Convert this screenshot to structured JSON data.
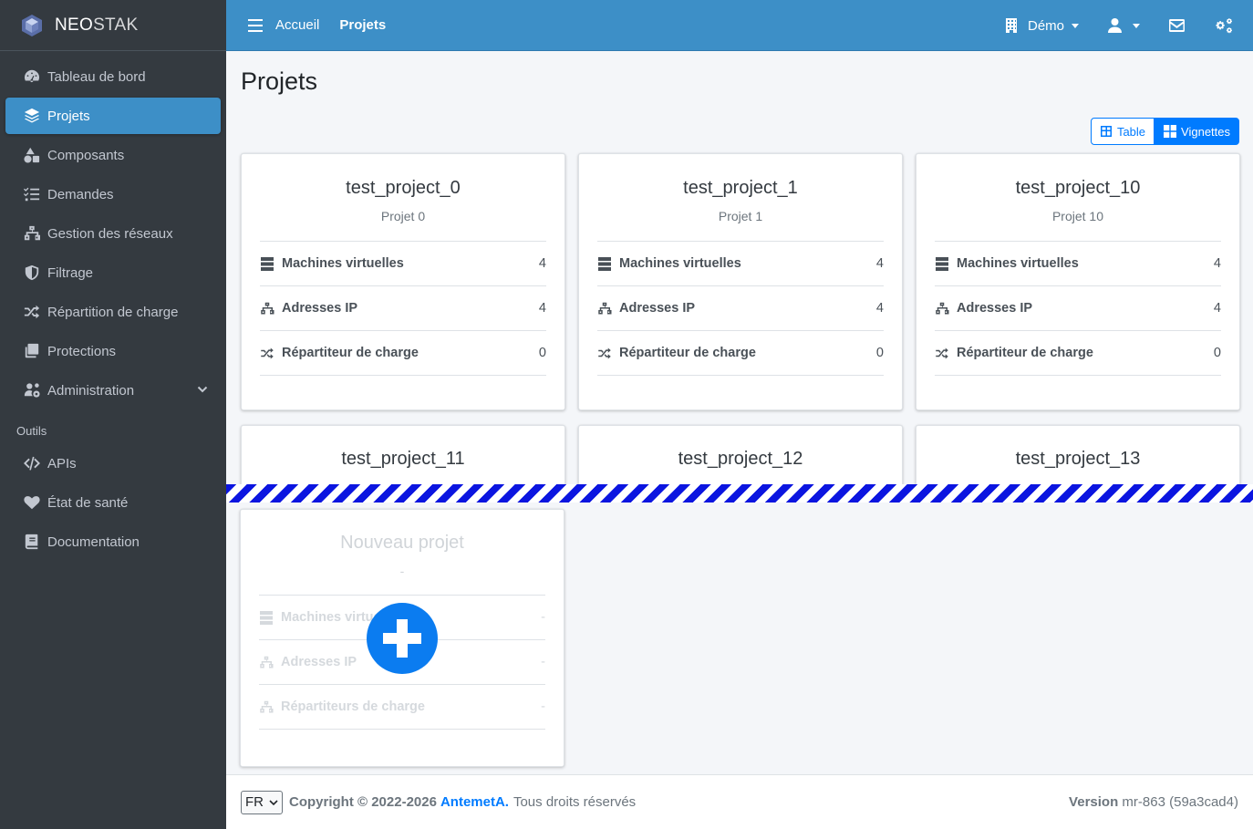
{
  "brand": {
    "name_strong": "NEO",
    "name_light": "STAK"
  },
  "sidebar": {
    "items": [
      {
        "label": "Tableau de bord"
      },
      {
        "label": "Projets"
      },
      {
        "label": "Composants"
      },
      {
        "label": "Demandes"
      },
      {
        "label": "Gestion des réseaux"
      },
      {
        "label": "Filtrage"
      },
      {
        "label": "Répartition de charge"
      },
      {
        "label": "Protections"
      },
      {
        "label": "Administration"
      }
    ],
    "section_header": "Outils",
    "tools": [
      {
        "label": "APIs"
      },
      {
        "label": "État de santé"
      },
      {
        "label": "Documentation"
      }
    ]
  },
  "topbar": {
    "breadcrumb_home": "Accueil",
    "breadcrumb_current": "Projets",
    "org_label": "Démo"
  },
  "page": {
    "title": "Projets"
  },
  "view_toggle": {
    "table": "Table",
    "tiles": "Vignettes",
    "active": "tiles"
  },
  "projects": [
    {
      "name": "test_project_0",
      "desc": "Projet 0",
      "vm_label": "Machines virtuelles",
      "vm": "4",
      "ip_label": "Adresses IP",
      "ip": "4",
      "lb_label": "Répartiteur de charge",
      "lb": "0"
    },
    {
      "name": "test_project_1",
      "desc": "Projet 1",
      "vm_label": "Machines virtuelles",
      "vm": "4",
      "ip_label": "Adresses IP",
      "ip": "4",
      "lb_label": "Répartiteur de charge",
      "lb": "0"
    },
    {
      "name": "test_project_10",
      "desc": "Projet 10",
      "vm_label": "Machines virtuelles",
      "vm": "4",
      "ip_label": "Adresses IP",
      "ip": "4",
      "lb_label": "Répartiteur de charge",
      "lb": "0"
    },
    {
      "name": "test_project_11"
    },
    {
      "name": "test_project_12"
    },
    {
      "name": "test_project_13"
    }
  ],
  "new_project": {
    "title": "Nouveau projet",
    "desc": "-",
    "vm_label": "Machines virtuelles",
    "vm": "-",
    "ip_label": "Adresses IP",
    "ip": "-",
    "lb_label": "Répartiteurs de charge",
    "lb": "-"
  },
  "footer": {
    "lang": "FR",
    "copyright": "Copyright © 2022-2026",
    "company": "AntemetA.",
    "rights": "Tous droits réservés",
    "version_label": "Version",
    "version_value": "mr-863 (59a3cad4)"
  },
  "colors": {
    "sidebar_bg": "#343a40",
    "topbar_bg": "#3d8fc7",
    "primary": "#007bff",
    "stripe": "#0b15e0"
  }
}
